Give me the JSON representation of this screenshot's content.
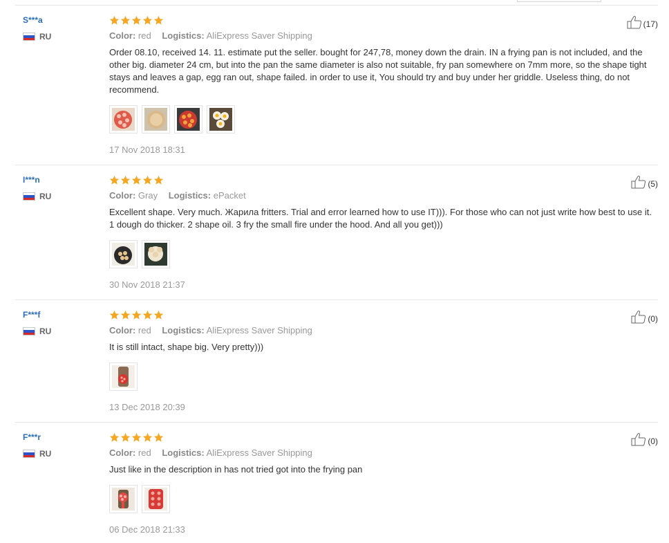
{
  "labels": {
    "color": "Color:",
    "logistics": "Logistics:"
  },
  "colors": {
    "username": "#2a6ebb",
    "star": "#f5a623",
    "text": "#333333",
    "muted": "#999999"
  },
  "reviews": [
    {
      "user": "S***a",
      "country": "RU",
      "stars": 5,
      "color": "red",
      "logistics": "AliExpress Saver Shipping",
      "text": "Order 08.10, received 14. 11. estimate put the seller. bought for 247,78, money down the drain. IN a frying pan is not included, and the other big. diameter 24 cm, but into the pan the same diameter is also not suitable, fry pan somewhere on 7mm more, so the shape tight stays and leaves a gap, egg ran out, shape failed. in order to use it, You should try and buy under her griddle. Useless thing, do not recommend.",
      "date": "17 Nov 2018 18:31",
      "useful": "(17)",
      "photos": [
        "silicone-mold-photo",
        "pancake-photo",
        "pan-mold-photo",
        "fried-eggs-photo"
      ]
    },
    {
      "user": "I***n",
      "country": "RU",
      "stars": 5,
      "color": "Gray",
      "logistics": "ePacket",
      "text": "Excellent shape. Very much. Жарила fritters. Trial and error learned how to use IT))). For those who can not just write how best to use it. 1 dough do thicker. 2 shape oil. 3 fry the small fire under the hood. And all you get)))",
      "date": "30 Nov 2018 21:37",
      "useful": "(5)",
      "photos": [
        "pan-fritters-photo",
        "fritters-photo"
      ]
    },
    {
      "user": "F***f",
      "country": "RU",
      "stars": 5,
      "color": "red",
      "logistics": "AliExpress Saver Shipping",
      "text": "It is still intact, shape big. Very pretty)))",
      "date": "13 Dec 2018 20:39",
      "useful": "(0)",
      "photos": [
        "mold-package-photo"
      ]
    },
    {
      "user": "F***r",
      "country": "RU",
      "stars": 5,
      "color": "red",
      "logistics": "AliExpress Saver Shipping",
      "text": "Just like in the description in has not tried got into the frying pan",
      "date": "06 Dec 2018 21:33",
      "useful": "(0)",
      "photos": [
        "red-mold-photo",
        "red-mold-closeup-photo"
      ]
    }
  ]
}
